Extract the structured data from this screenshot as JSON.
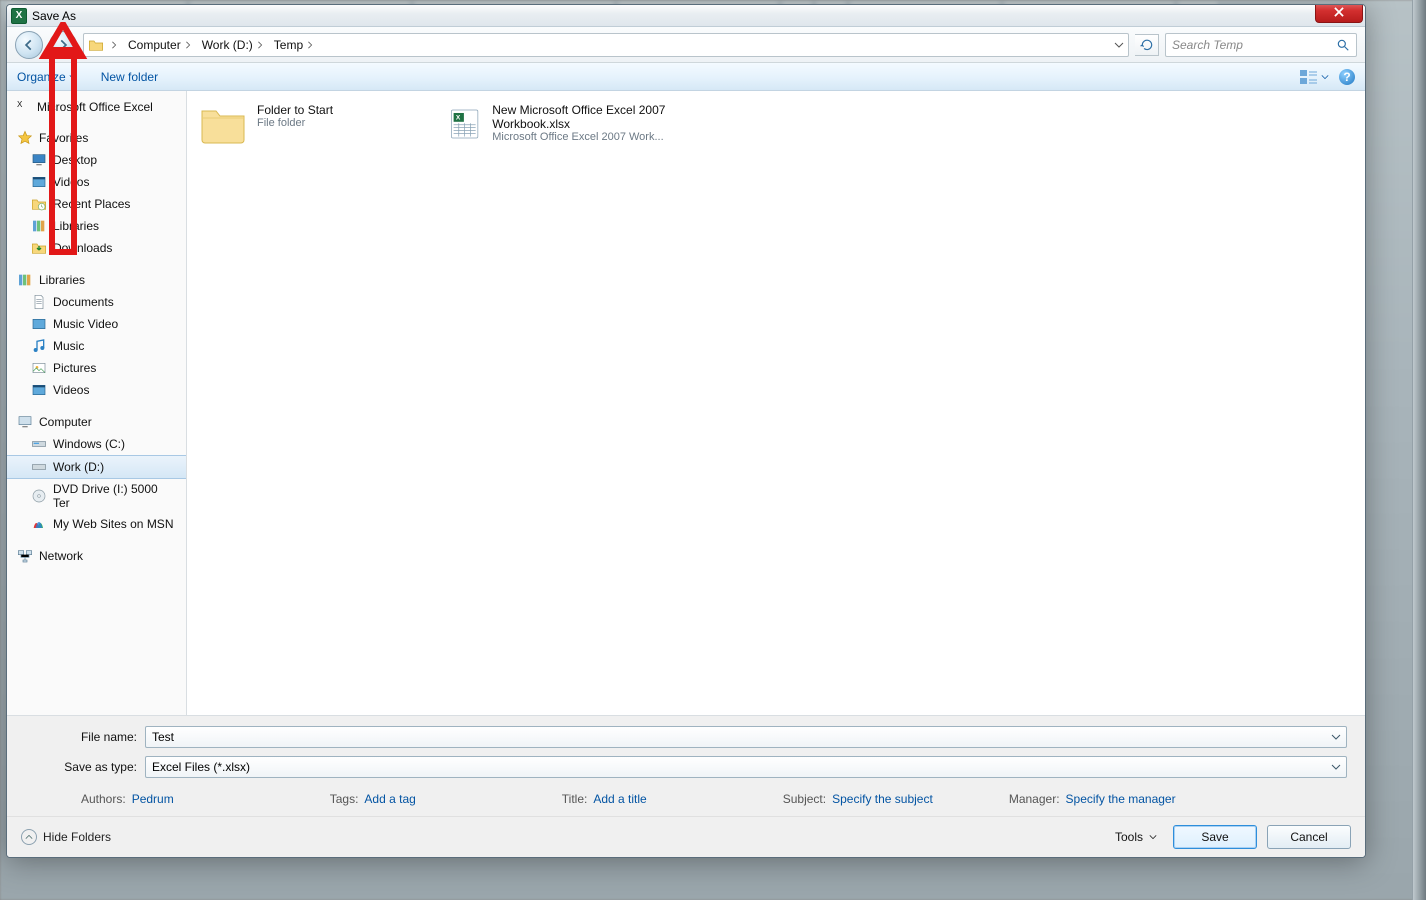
{
  "title": "Save As",
  "breadcrumbs": [
    "Computer",
    "Work (D:)",
    "Temp"
  ],
  "search_placeholder": "Search Temp",
  "toolbar": {
    "organize": "Organize",
    "newfolder": "New folder"
  },
  "nav": {
    "excel": "Microsoft Office Excel",
    "favorites": "Favorites",
    "fav_items": [
      "Desktop",
      "Videos",
      "Recent Places",
      "Libraries",
      "Downloads"
    ],
    "libraries": "Libraries",
    "lib_items": [
      "Documents",
      "Music Video",
      "Music",
      "Pictures",
      "Videos"
    ],
    "computer": "Computer",
    "comp_items": [
      "Windows (C:)",
      "Work (D:)",
      "DVD Drive (I:) 5000 Ter",
      "My Web Sites on MSN"
    ],
    "comp_selected": "Work (D:)",
    "network": "Network"
  },
  "items": [
    {
      "name": "Folder to Start",
      "sub": "File folder"
    },
    {
      "name": "New Microsoft Office Excel 2007 Workbook.xlsx",
      "sub": "Microsoft Office Excel 2007 Work..."
    }
  ],
  "filename_label": "File name:",
  "filename_value": "Test",
  "type_label": "Save as type:",
  "type_value": "Excel Files (*.xlsx)",
  "meta": {
    "authors_l": "Authors:",
    "authors_v": "Pedrum",
    "tags_l": "Tags:",
    "tags_v": "Add a tag",
    "title_l": "Title:",
    "title_v": "Add a title",
    "subject_l": "Subject:",
    "subject_v": "Specify the subject",
    "manager_l": "Manager:",
    "manager_v": "Specify the manager"
  },
  "footer": {
    "hide": "Hide Folders",
    "tools": "Tools",
    "save": "Save",
    "cancel": "Cancel"
  }
}
